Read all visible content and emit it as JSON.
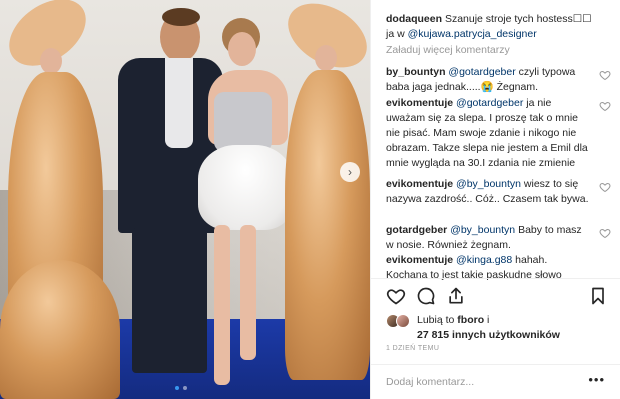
{
  "post": {
    "author": "dodaqueen",
    "caption_text": "Szanuje stroje tych hostess☐☐",
    "caption_line2_prefix": "ja w ",
    "caption_mention": "@kujawa.patrycja_designer",
    "load_more": "Załaduj więcej komentarzy"
  },
  "comments": [
    {
      "user": "by_bountyn",
      "mention": "@gotardgeber",
      "text": " czyli typowa baba jaga jednak.....😭 Żegnam."
    },
    {
      "user": "evikomentuje",
      "mention": "@gotardgeber",
      "text": " ja nie uważam się za slepa. I proszę tak o mnie nie pisać. Mam swoje zdanie i nikogo nie obrazam. Takze slepa nie jestem a Emil dla mnie wygląda na 30.I zdania nie zmienie"
    },
    {
      "user": "evikomentuje",
      "mention": "@by_bountyn",
      "text": " wiesz to się nazywa zazdrość.. Cóż.. Czasem tak bywa."
    },
    {
      "user": "gotardgeber",
      "mention": "@by_bountyn",
      "text": " Baby to masz w nosie. Również żegnam."
    },
    {
      "user": "evikomentuje",
      "mention": "@kinga.g88",
      "text": " hahah. Kochana to jest takie paskudne słowo"
    }
  ],
  "likes": {
    "prefix": "Lubią to ",
    "user": "fboro",
    "middle": " i",
    "count": "27 815 innych użytkowników"
  },
  "time": "1 DZIEŃ TEMU",
  "add_comment_placeholder": "Dodaj komentarz...",
  "more_label": "•••",
  "next_arrow": "›",
  "icons": {
    "heart": "heart-icon",
    "comment": "comment-icon",
    "share": "share-icon",
    "bookmark": "bookmark-icon"
  },
  "colors": {
    "mention": "#003569",
    "secondary": "#999999",
    "carousel_active": "#3897f0"
  }
}
